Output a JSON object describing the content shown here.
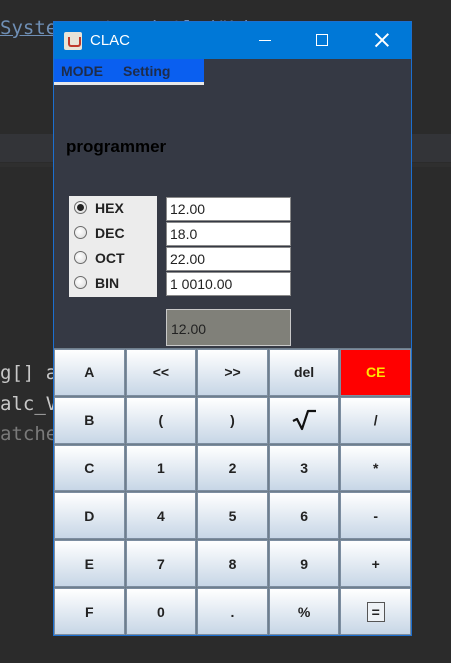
{
  "background_code": {
    "top_line": "System.out.println(\"Licensee",
    "line1": "g[] a",
    "line2": "alc_V",
    "line3": "atche"
  },
  "window": {
    "title": "CLAC",
    "title_bar_color": "#0078d7"
  },
  "menu": {
    "items": [
      "MODE",
      "Setting"
    ]
  },
  "mode_label": "programmer",
  "bases": [
    {
      "label": "HEX",
      "value": "12.00",
      "checked": true
    },
    {
      "label": "DEC",
      "value": "18.0",
      "checked": false
    },
    {
      "label": "OCT",
      "value": "22.00",
      "checked": false
    },
    {
      "label": "BIN",
      "value": "1 0010.00",
      "checked": false
    }
  ],
  "result_display": "12.00",
  "keypad": {
    "rows": [
      [
        "A",
        "<<",
        ">>",
        "del",
        "CE"
      ],
      [
        "B",
        "(",
        ")",
        "sqrt-icon",
        "/"
      ],
      [
        "C",
        "1",
        "2",
        "3",
        "*"
      ],
      [
        "D",
        "4",
        "5",
        "6",
        "-"
      ],
      [
        "E",
        "7",
        "8",
        "9",
        "+"
      ],
      [
        "F",
        "0",
        ".",
        "%",
        "="
      ]
    ],
    "ce_color": "#ff0000",
    "ce_text_color": "#ffe600"
  }
}
